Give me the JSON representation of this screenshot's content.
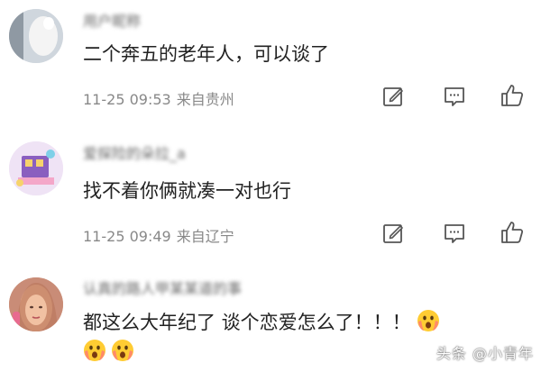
{
  "comments": [
    {
      "username": "用户昵称",
      "text": "二个奔五的老年人，可以谈了",
      "time": "11-25 09:53",
      "location": "来自贵州"
    },
    {
      "username": "爱探险的朵拉_a",
      "text": "找不着你俩就凑一对也行",
      "time": "11-25 09:49",
      "location": "来自辽宁"
    },
    {
      "username": "认真的路人甲某某道的事",
      "text": "都这么大年纪了 谈个恋爱怎么了！！！",
      "time": "",
      "location": ""
    }
  ],
  "icons": {
    "edit": "edit-icon",
    "comment": "comment-icon",
    "like": "thumbs-up-icon",
    "emoji": "shocked-emoji-icon"
  },
  "watermark": "头条 @小青年",
  "colors": {
    "text": "#222222",
    "meta": "#888888",
    "icon": "#555555"
  }
}
